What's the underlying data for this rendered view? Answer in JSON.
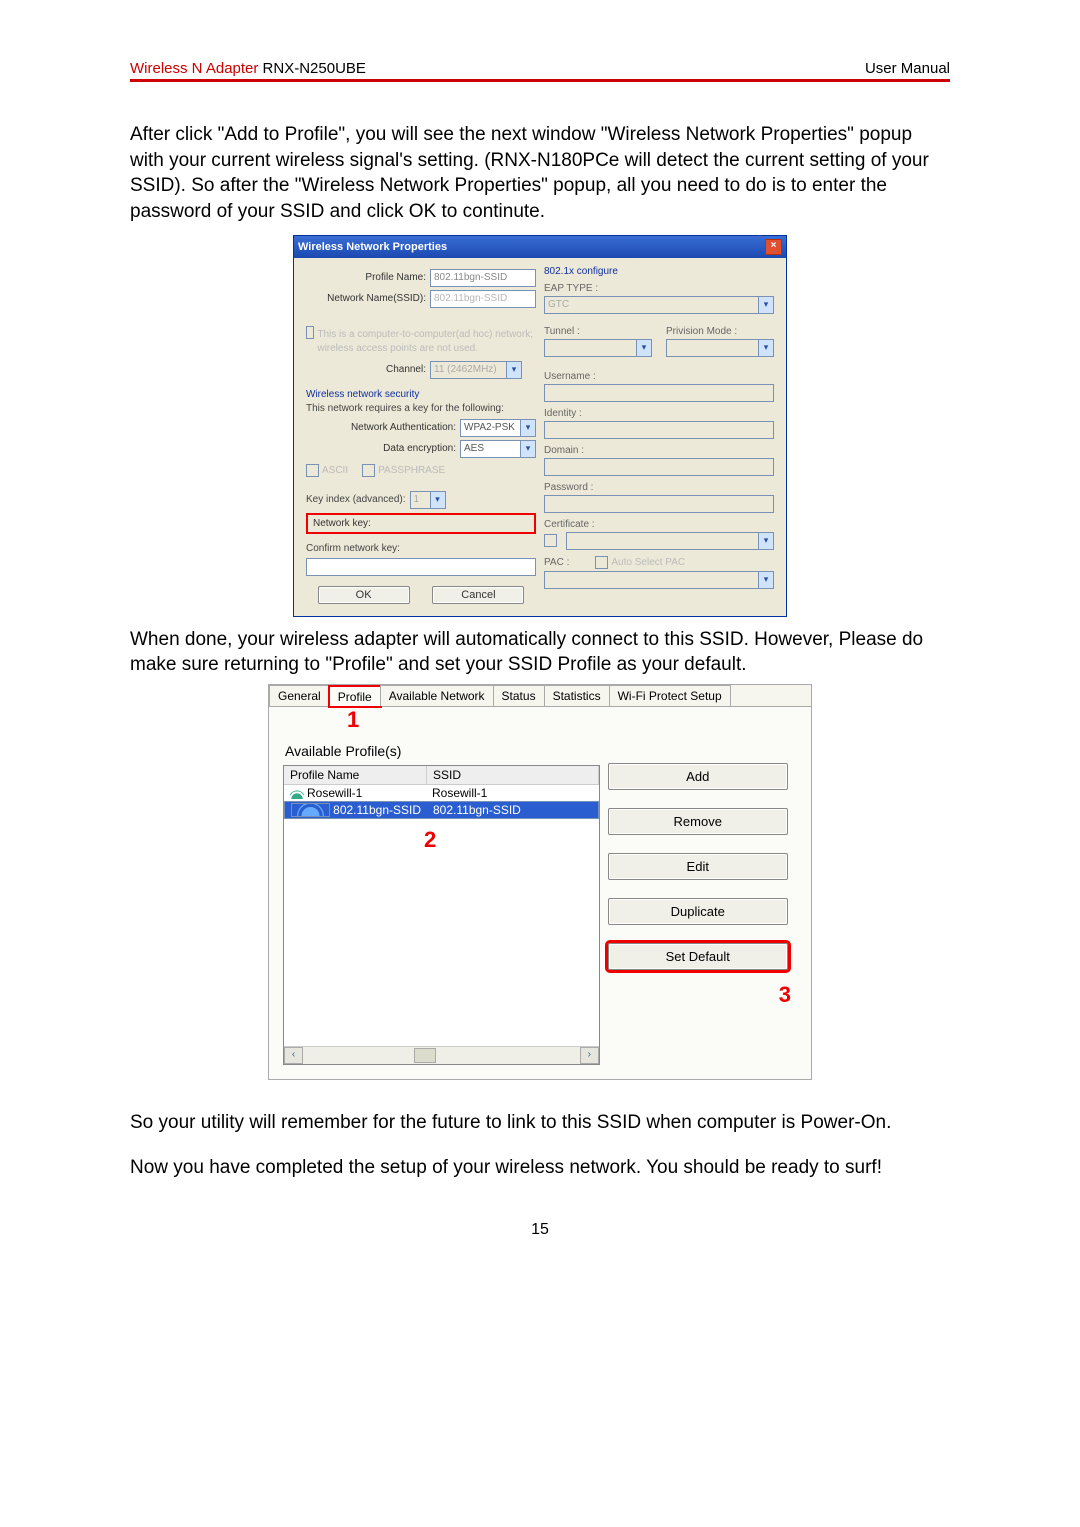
{
  "header": {
    "product_red": "Wireless N Adapter",
    "product_model": " RNX-N250UBE",
    "right": "User Manual"
  },
  "para1": "After click \"Add to Profile\", you will see the next window \"Wireless Network Properties\" popup with your current wireless signal's setting. (RNX-N180PCe will detect the current setting of your SSID). So after the \"Wireless Network Properties\" popup, all you need to do is to enter the password of your SSID and click OK to continute.",
  "dlg1": {
    "title": "Wireless Network Properties",
    "profile_name_label": "Profile Name:",
    "profile_name_value": "802.11bgn-SSID",
    "network_name_label": "Network Name(SSID):",
    "network_name_value": "802.11bgn-SSID",
    "adhoc_text": "This is a computer-to-computer(ad hoc) network; wireless access points are not used.",
    "channel_label": "Channel:",
    "channel_value": "11 (2462MHz)",
    "security_section": "Wireless network security",
    "req_key_text": "This network requires a key for the following:",
    "auth_label": "Network Authentication:",
    "auth_value": "WPA2-PSK",
    "enc_label": "Data encryption:",
    "enc_value": "AES",
    "ascii_label": "ASCII",
    "pass_label": "PASSPHRASE",
    "keyidx_label": "Key index (advanced):",
    "keyidx_value": "1",
    "netkey_label": "Network key:",
    "confirm_label": "Confirm network key:",
    "ok_btn": "OK",
    "cancel_btn": "Cancel",
    "r_title": "802.1x configure",
    "eap_label": "EAP TYPE :",
    "eap_value": "GTC",
    "tunnel_label": "Tunnel :",
    "prov_label": "Privision Mode :",
    "username_label": "Username :",
    "identity_label": "Identity :",
    "domain_label": "Domain :",
    "password_label": "Password :",
    "cert_label": "Certificate :",
    "pac_label": "PAC :",
    "autopac_label": "Auto Select PAC"
  },
  "para2": "When done, your wireless adapter will automatically connect to this SSID. However, Please do make sure returning to \"Profile\" and set your SSID Profile as your default.",
  "dlg2": {
    "tabs": [
      "General",
      "Profile",
      "Available Network",
      "Status",
      "Statistics",
      "Wi-Fi Protect Setup"
    ],
    "callout1": "1",
    "available_label": "Available Profile(s)",
    "col_profile": "Profile Name",
    "col_ssid": "SSID",
    "rows": [
      {
        "name": "Rosewill-1",
        "ssid": "Rosewill-1",
        "selected": false
      },
      {
        "name": "802.11bgn-SSID",
        "ssid": "802.11bgn-SSID",
        "selected": true
      }
    ],
    "callout2": "2",
    "buttons": {
      "add": "Add",
      "remove": "Remove",
      "edit": "Edit",
      "duplicate": "Duplicate",
      "setdefault": "Set Default"
    },
    "callout3": "3"
  },
  "para3": "So your utility will remember for the future to link to this SSID when computer is Power-On.",
  "para4": "Now you have completed the setup of your wireless network. You should be ready to surf!",
  "page_number": "15"
}
